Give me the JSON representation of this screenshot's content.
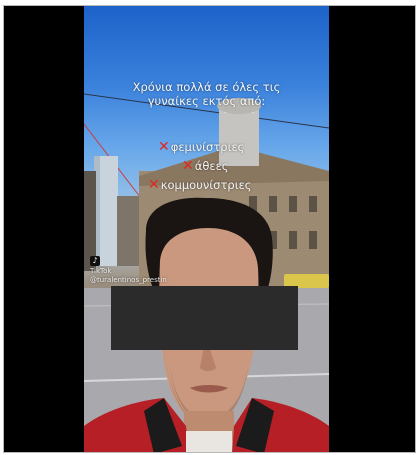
{
  "caption": {
    "line1": "Χρόνια πολλά σε όλες τις",
    "line2": "γυναίκες εκτός από:"
  },
  "excluded_list": [
    {
      "mark": "✕",
      "label": "φεμινίστριες"
    },
    {
      "mark": "✕",
      "label": "άθεες"
    },
    {
      "mark": "✕",
      "label": "κομμουνίστριες"
    }
  ],
  "watermark": {
    "app": "TikTok",
    "logo": "♪",
    "handle": "@turalentinos_prestin"
  },
  "colors": {
    "cross_mark": "#e0261f",
    "redaction_box": "#2b2b2b",
    "letterbox": "#000000"
  }
}
